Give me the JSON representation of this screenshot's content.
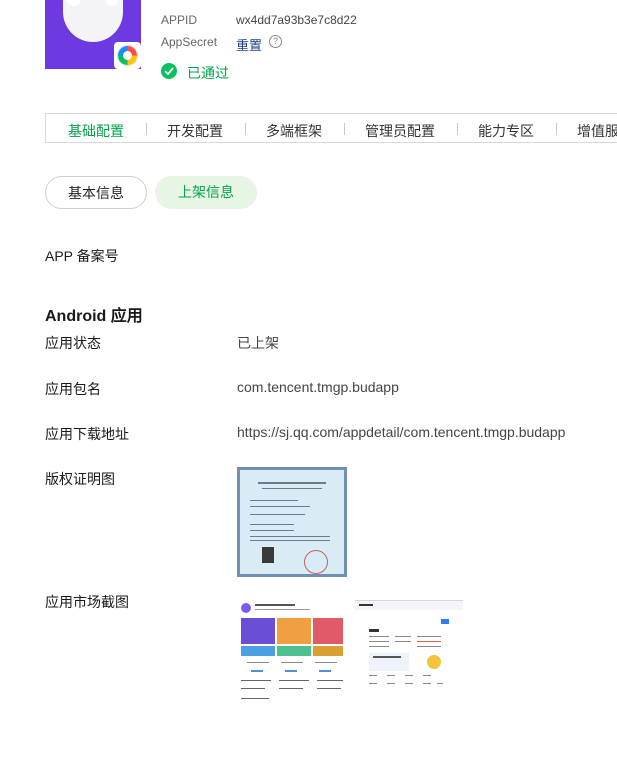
{
  "header": {
    "appid_label": "APPID",
    "appid_value": "wx4dd7a93b3e7c8d22",
    "secret_label": "AppSecret",
    "secret_action": "重置",
    "help_symbol": "?",
    "status_text": "已通过"
  },
  "tabs": [
    {
      "label": "基础配置",
      "active": true
    },
    {
      "label": "开发配置"
    },
    {
      "label": "多端框架"
    },
    {
      "label": "管理员配置"
    },
    {
      "label": "能力专区"
    },
    {
      "label": "增值服"
    }
  ],
  "subtabs": {
    "basic": "基本信息",
    "listing": "上架信息"
  },
  "filing": {
    "label": "APP 备案号"
  },
  "android": {
    "section_title": "Android 应用",
    "status_label": "应用状态",
    "status_value": "已上架",
    "package_label": "应用包名",
    "package_value": "com.tencent.tmgp.budapp",
    "download_label": "应用下载地址",
    "download_value": "https://sj.qq.com/appdetail/com.tencent.tmgp.budapp",
    "copyright_label": "版权证明图",
    "screenshots_label": "应用市场截图"
  },
  "colors": {
    "accent_green": "#07a04c",
    "icon_purple": "#6c3ae0",
    "link_blue": "#1f3e8c"
  },
  "icons": {
    "status": "check-circle-icon",
    "help": "question-circle-icon",
    "badge": "mini-program-icon"
  }
}
